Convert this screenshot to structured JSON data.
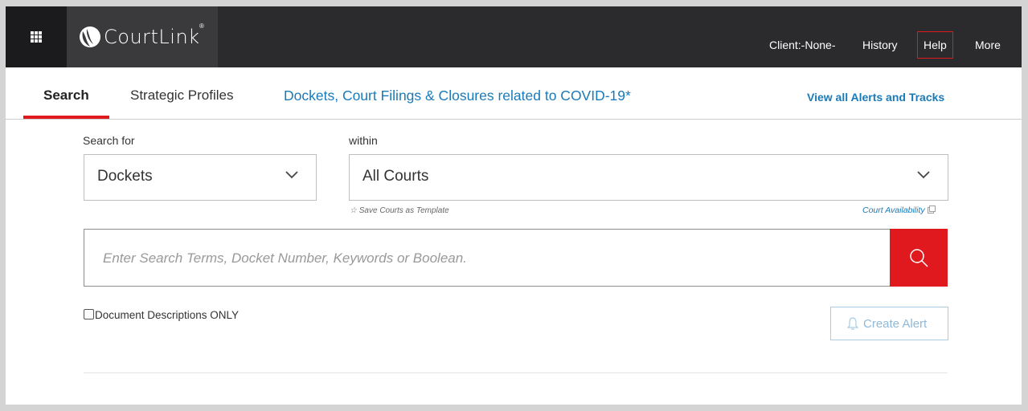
{
  "header": {
    "app_name": "CourtLink",
    "registered_mark": "®",
    "nav": {
      "client": "Client:-None-",
      "history": "History",
      "help": "Help",
      "more": "More"
    }
  },
  "tabs": {
    "search": "Search",
    "strategic_profiles": "Strategic Profiles",
    "covid": "Dockets, Court Filings & Closures related to COVID-19*",
    "active": "Search"
  },
  "alerts_link": "View all Alerts and Tracks",
  "form": {
    "search_for_label": "Search for",
    "search_for_value": "Dockets",
    "within_label": "within",
    "within_value": "All Courts",
    "save_template": "☆ Save Courts as Template",
    "court_availability": "Court Availability",
    "search_placeholder": "Enter Search Terms, Docket Number, Keywords or Boolean.",
    "doc_descriptions_only": "Document Descriptions ONLY",
    "create_alert": "Create Alert"
  },
  "colors": {
    "accent_red": "#e0191f",
    "link_blue": "#1a7ab8",
    "header_bg": "#2b2b2d"
  },
  "icons": [
    "grid-icon",
    "courtlink-logo-icon",
    "chevron-down-icon",
    "search-icon",
    "external-link-icon",
    "bell-icon",
    "star-icon"
  ]
}
